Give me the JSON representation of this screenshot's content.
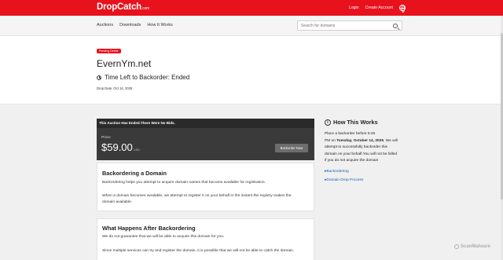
{
  "header": {
    "logo": "DropCatch",
    "logo_suffix": ".com",
    "login": "Login",
    "create_account": "Create Account",
    "globe_icon": "globe-icon"
  },
  "nav": {
    "items": [
      "Auctions",
      "Downloads",
      "How It Works"
    ],
    "search_placeholder": "Search for domains"
  },
  "hero": {
    "badge": "Pending Delete",
    "domain": "EvernYm.net",
    "time_left": "Time Left to Backorder: Ended",
    "drop_date": "Drop Date: Oct 14, 2025"
  },
  "auction": {
    "header": "This Auction Has Ended.There Were No Bids.",
    "price_label": "Price:",
    "price": "$59.00",
    "currency": "USD",
    "button": "Backorder Now"
  },
  "cards": [
    {
      "title": "Backordering a Domain",
      "paragraphs": [
        "Backordering helps you attempt to acquire domain names that become available for registration.",
        "When a domain becomes available, we attempt to register it on your behalf in the instant the registry makes the",
        "domain available."
      ]
    },
    {
      "title": "What Happens After Backordering",
      "paragraphs": [
        "We do not guarantee that we will be able to acquire this domain for you.",
        "Since multiple services can try and register the domain, it is possible that we will not be able to catch the domain."
      ]
    }
  ],
  "sidebar": {
    "title": "How This Works",
    "text_1": "Place a backorder before 5:45",
    "text_2": "PM on ",
    "text_bold": "Tuesday, October 14, 2025",
    "text_3": ". We will",
    "text_4": "attempt to successfully backorder this",
    "text_5": "domain on your behalf.You will not be billed",
    "text_6": "if you do not acquire the domain",
    "links": [
      "Backordering",
      "Domain Drop Process"
    ]
  },
  "watermark": "ScanMalware",
  "colors": {
    "brand_red": "#e8121c",
    "dark_panel": "#3a3a3a",
    "link_blue": "#1a5fb4"
  }
}
